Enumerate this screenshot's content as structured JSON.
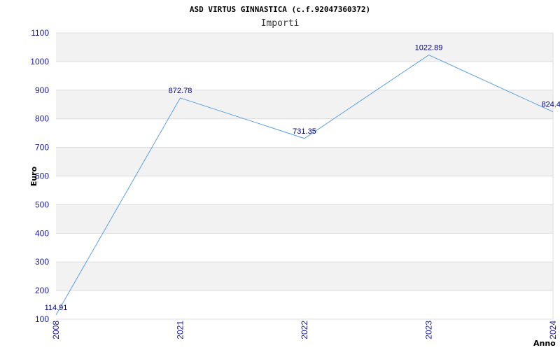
{
  "chart_data": {
    "type": "line",
    "title": "ASD VIRTUS GINNASTICA (c.f.92047360372)",
    "subtitle": "Importi",
    "xlabel": "Anno",
    "ylabel": "Euro",
    "categories": [
      "2008",
      "2021",
      "2022",
      "2023",
      "2024"
    ],
    "values": [
      114.91,
      872.78,
      731.35,
      1022.89,
      824.4
    ],
    "data_labels": [
      "114.91",
      "872.78",
      "731.35",
      "1022.89",
      "824.4"
    ],
    "yticks": [
      "100",
      "200",
      "300",
      "400",
      "500",
      "600",
      "700",
      "800",
      "900",
      "1000",
      "1100"
    ],
    "ylim": [
      100,
      1100
    ],
    "grid": true,
    "colors": {
      "line": "#5aa0e6",
      "band": "#f2f2f2",
      "grid": "#dddddd",
      "tick_text": "#1a1aa6"
    }
  }
}
